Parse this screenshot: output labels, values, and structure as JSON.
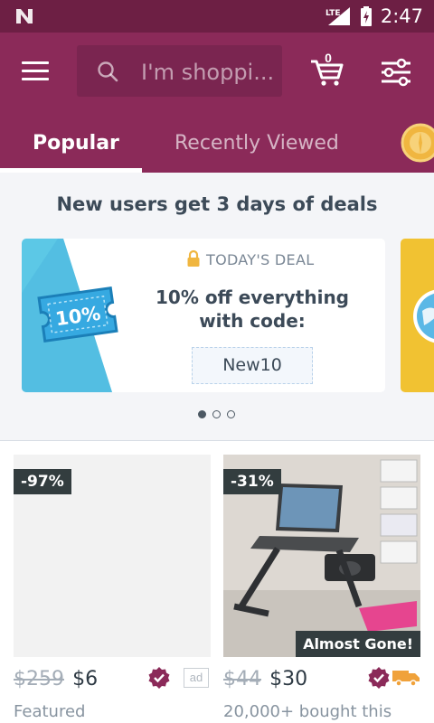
{
  "status_bar": {
    "time": "2:47",
    "network": "LTE"
  },
  "search": {
    "placeholder": "I'm shoppi..."
  },
  "cart": {
    "count": "0"
  },
  "tabs": [
    {
      "label": "Popular",
      "active": true
    },
    {
      "label": "Recently Viewed",
      "active": false
    }
  ],
  "promo": {
    "title": "New users get 3 days of deals",
    "deal_label": "TODAY'S DEAL",
    "deal_text": "10% off everything with code:",
    "code": "New10",
    "ticket_text": "10%"
  },
  "carousel": {
    "pages": 3,
    "active_page": 1
  },
  "products": [
    {
      "discount": "-97%",
      "old_price": "$259",
      "price": "$6",
      "sub_label": "Featured",
      "ad_label": "ad",
      "badge": ""
    },
    {
      "discount": "-31%",
      "old_price": "$44",
      "price": "$30",
      "sub_label": "20,000+ bought this",
      "badge": "Almost Gone!"
    }
  ],
  "colors": {
    "brand": "#8b2a59",
    "status_bar": "#6d1f44",
    "badge_dark": "#333d3f",
    "accent_orange": "#f0a23b"
  }
}
